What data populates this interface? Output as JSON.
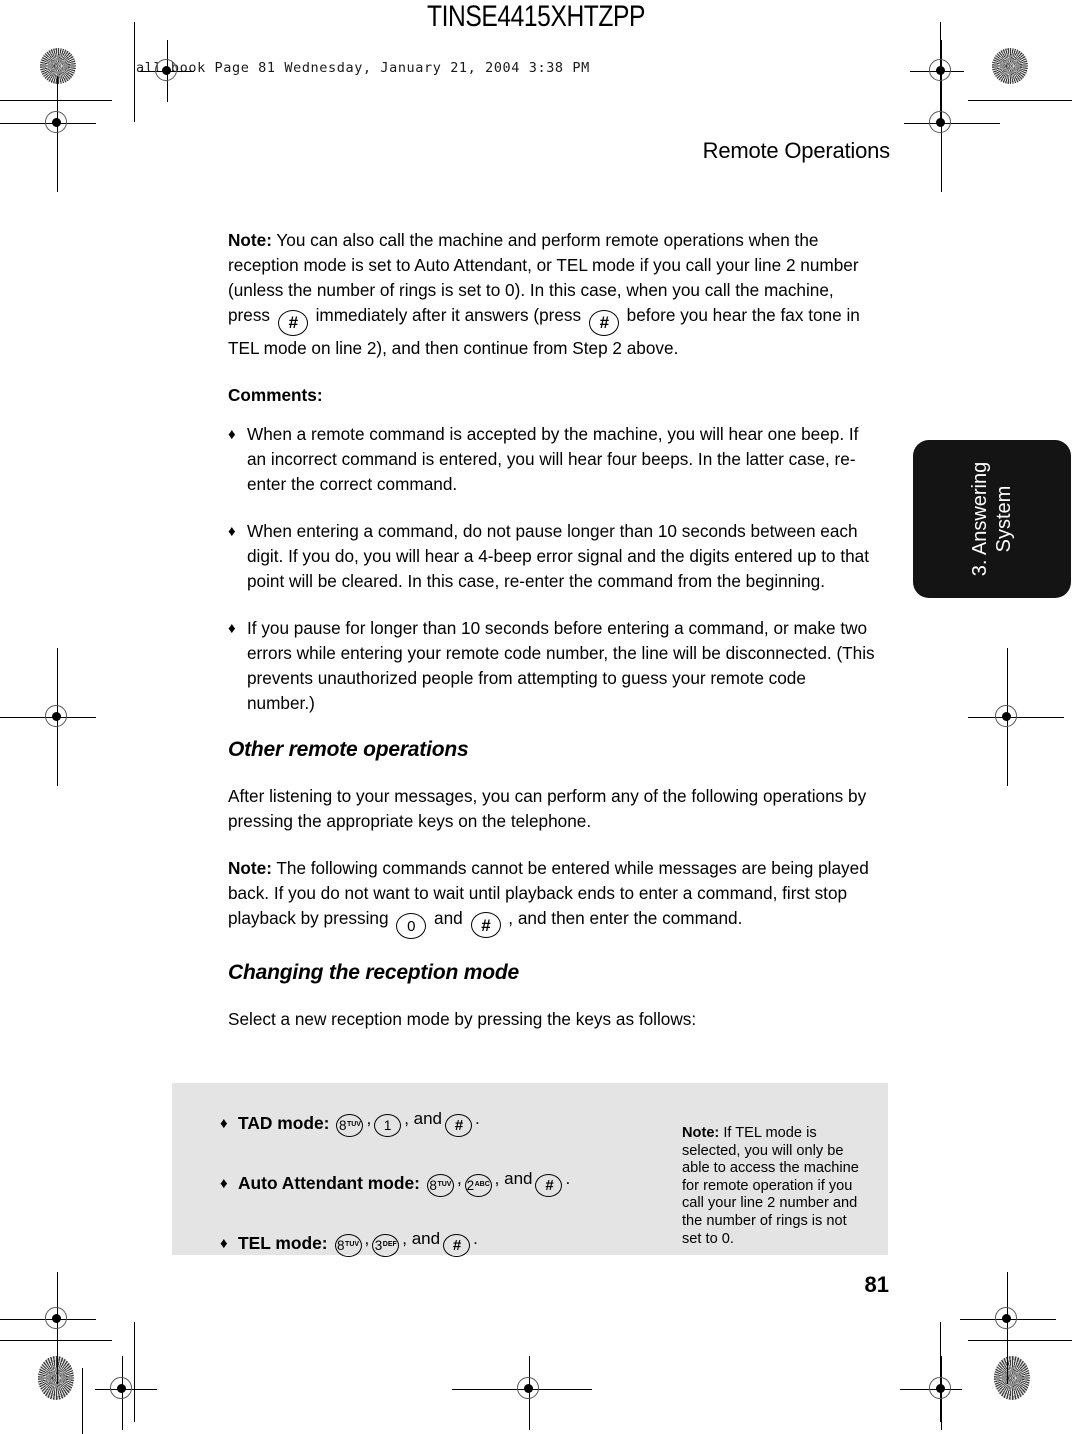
{
  "print_marks": {
    "plate_code": "TINSE4415XHTZPP",
    "file_stamp": "all.book  Page 81  Wednesday, January 21, 2004  3:38 PM"
  },
  "header": {
    "running_head": "Remote Operations"
  },
  "footer": {
    "page_number": "81"
  },
  "side_tab": {
    "label": "3. Answering\nSystem"
  },
  "body": {
    "note1": {
      "lead": "Note:",
      "part1": " You can also call the machine and perform remote operations when the reception mode is set to Auto Attendant, or TEL mode if you call your line 2 number (unless the number of rings is set to 0). In this case, when you call the machine, press ",
      "part2": " immediately after it answers (press ",
      "part3": " before you hear the fax tone in TEL mode on line 2), and then continue from Step 2 above.",
      "key1": "#",
      "key2": "#"
    },
    "comments_heading": "Comments:",
    "comments": [
      {
        "bullet": "♦",
        "text": "When a remote command is accepted by the machine, you will hear one beep. If an incorrect command is entered, you will hear four beeps. In the latter case, re-enter the correct command."
      },
      {
        "bullet": "♦",
        "text": "When entering a command, do not pause longer than 10 seconds between each digit. If you do, you will hear a 4-beep error signal and the digits entered up to that point will be cleared. In this case, re-enter the command from the beginning."
      },
      {
        "bullet": "♦",
        "text": "If you pause for longer than 10 seconds before entering a command, or make two errors while entering your remote code number, the line will be disconnected. (This prevents unauthorized people from attempting to guess your remote code number.)"
      }
    ],
    "section1_heading": "Other remote operations",
    "section1_para": "After listening to your messages, you can perform any of the following operations by pressing the appropriate keys on the telephone.",
    "note2": {
      "lead": "Note:",
      "part1": " The following commands cannot be entered while messages are being played back. If you do not want to wait until playback ends to enter a command, first stop playback by pressing ",
      "part2": " and ",
      "part3": " , and then enter the command.",
      "key1": "0",
      "key2": "#"
    },
    "section2_heading": "Changing the reception mode",
    "section2_para": "Select a new reception mode by pressing the keys as follows:"
  },
  "callout": {
    "rows": [
      {
        "bullet": "♦",
        "label": "TAD mode:",
        "keys": [
          {
            "num": "8",
            "letters": "TUV"
          },
          {
            "num": "1",
            "letters": ""
          },
          {
            "num": "#",
            "letters": ""
          }
        ],
        "sep1": ",",
        "sep2": ", and",
        "end": "."
      },
      {
        "bullet": "♦",
        "label": "Auto Attendant mode:",
        "keys": [
          {
            "num": "8",
            "letters": "TUV"
          },
          {
            "num": "2",
            "letters": "ABC"
          },
          {
            "num": "#",
            "letters": ""
          }
        ],
        "sep1": ",",
        "sep2": ", and",
        "end": "."
      },
      {
        "bullet": "♦",
        "label": "TEL mode:",
        "keys": [
          {
            "num": "8",
            "letters": "TUV"
          },
          {
            "num": "3",
            "letters": "DEF"
          },
          {
            "num": "#",
            "letters": ""
          }
        ],
        "sep1": ",",
        "sep2": ", and",
        "end": "."
      }
    ],
    "note": {
      "lead": "Note:",
      "text": " If TEL mode is selected, you will only be able to access the machine for remote operation if you call your line 2 number and the number of rings is not set to 0."
    }
  },
  "colors": {
    "callout_background": "#e4e4e4",
    "side_tab_background": "#141414",
    "text": "#000000"
  }
}
